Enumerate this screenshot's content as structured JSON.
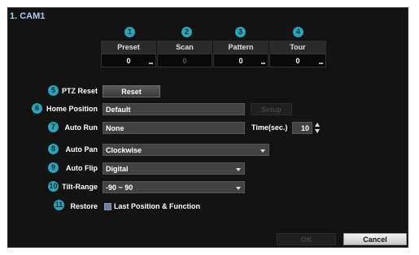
{
  "window": {
    "title": "1. CAM1"
  },
  "actions_grid": {
    "columns": [
      {
        "badge": "1",
        "label": "Preset",
        "value": "0",
        "enabled": true
      },
      {
        "badge": "2",
        "label": "Scan",
        "value": "0",
        "enabled": false
      },
      {
        "badge": "3",
        "label": "Pattern",
        "value": "0",
        "enabled": true
      },
      {
        "badge": "4",
        "label": "Tour",
        "value": "0",
        "enabled": true
      }
    ]
  },
  "settings": {
    "ptz_reset": {
      "badge": "5",
      "label": "PTZ Reset",
      "button": "Reset"
    },
    "home_position": {
      "badge": "6",
      "label": "Home Position",
      "value": "Default",
      "button": "Setup"
    },
    "auto_run": {
      "badge": "7",
      "label": "Auto Run",
      "value": "None",
      "time_label": "Time(sec.)",
      "time_value": "10"
    },
    "auto_pan": {
      "badge": "8",
      "label": "Auto Pan",
      "value": "Clockwise"
    },
    "auto_flip": {
      "badge": "9",
      "label": "Auto Flip",
      "value": "Digital"
    },
    "tilt_range": {
      "badge": "10",
      "label": "Tilt-Range",
      "value": "-90 ~ 90"
    },
    "restore": {
      "badge": "11",
      "label": "Restore",
      "checkbox_label": "Last Position & Function",
      "checked": true
    }
  },
  "footer": {
    "ok": "OK",
    "cancel": "Cancel"
  },
  "colors": {
    "badge": "#2aa4b6",
    "title": "#a9cdf0",
    "panel": "#131313"
  }
}
